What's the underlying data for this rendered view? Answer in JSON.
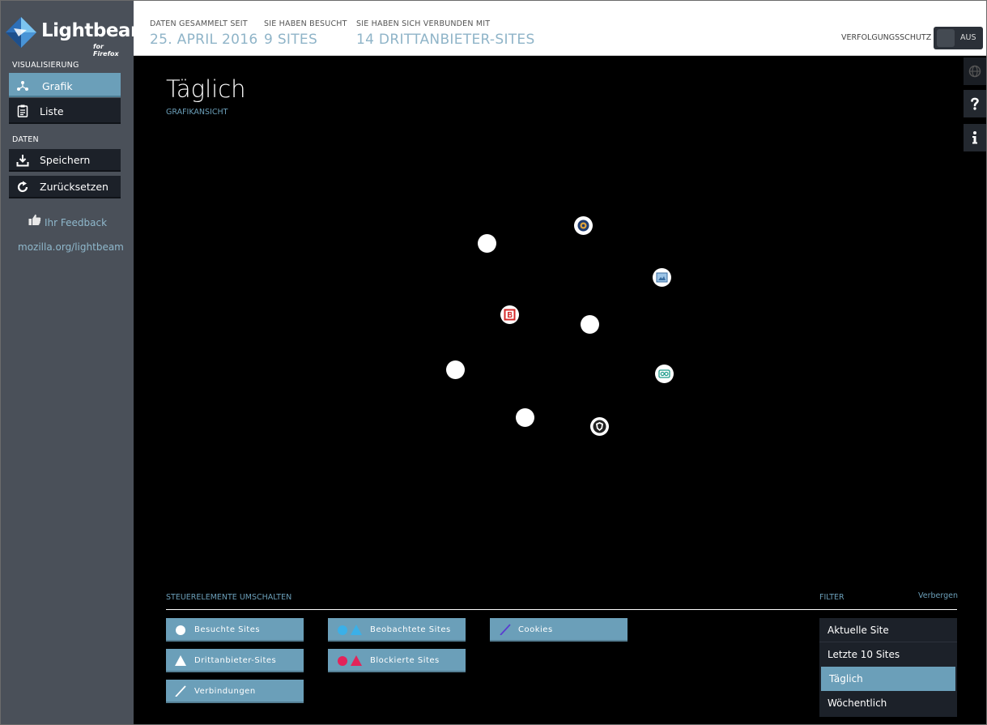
{
  "app": {
    "name": "Lightbeam",
    "tagline": "for Firefox"
  },
  "sidebar": {
    "visualization_title": "VISUALISIERUNG",
    "graph_label": "Grafik",
    "list_label": "Liste",
    "data_title": "DATEN",
    "save_label": "Speichern",
    "reset_label": "Zurücksetzen",
    "feedback_label": "Ihr Feedback",
    "link_label": "mozilla.org/lightbeam"
  },
  "header": {
    "since_label": "DATEN GESAMMELT SEIT",
    "since_value": "25. APRIL 2016",
    "visited_label": "SIE HABEN BESUCHT",
    "visited_value": "9 SITES",
    "connected_label": "SIE HABEN SICH VERBUNDEN MIT",
    "connected_value": "14 DRITTANBIETER-SITES",
    "tracking_label": "VERFOLGUNGSSCHUTZ",
    "tracking_state": "AUS"
  },
  "main": {
    "title": "Täglich",
    "subtitle": "GRAFIKANSICHT"
  },
  "controls": {
    "title": "STEUERELEMENTE UMSCHALTEN",
    "visited_sites": "Besuchte Sites",
    "third_party_sites": "Drittanbieter-Sites",
    "connections": "Verbindungen",
    "watched_sites": "Beobachtete Sites",
    "blocked_sites": "Blockierte Sites",
    "cookies": "Cookies"
  },
  "filter": {
    "title": "FILTER",
    "hide_label": "Verbergen",
    "current_site": "Aktuelle Site",
    "last_10": "Letzte 10 Sites",
    "daily": "Täglich",
    "weekly": "Wöchentlich"
  },
  "colors": {
    "accent": "#6b9fb9",
    "sidebar": "#4a5059",
    "watched": "#3bb0e8",
    "blocked": "#e3245a",
    "cookie_line": "#5a3cd0"
  }
}
